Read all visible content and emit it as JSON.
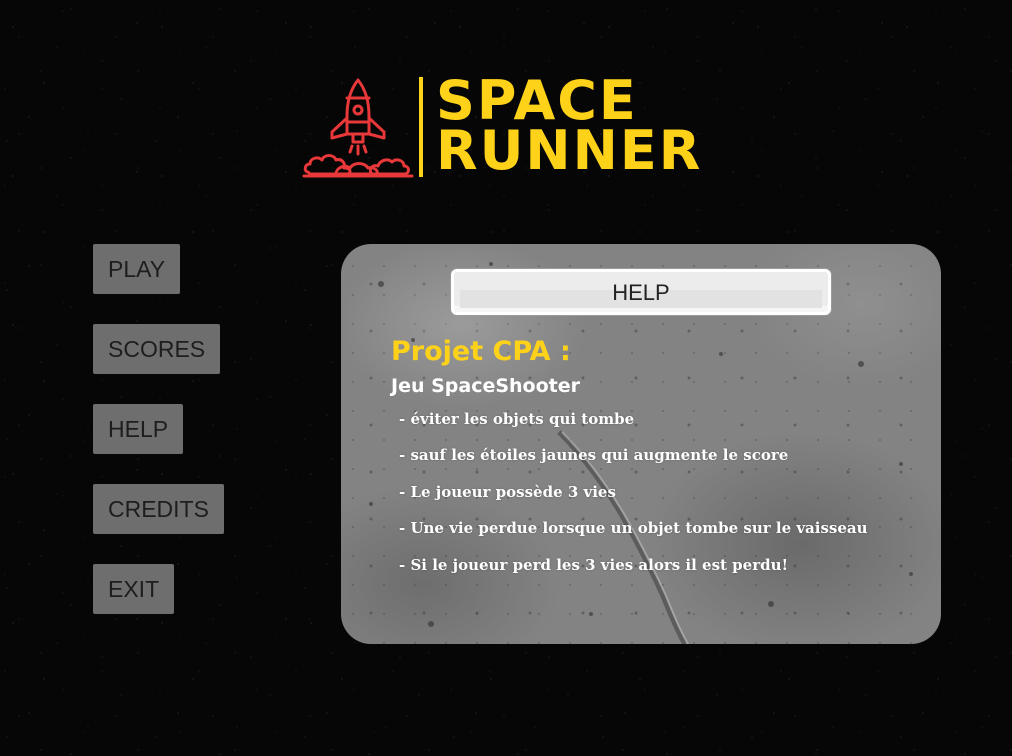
{
  "logo": {
    "line1": "SPACE",
    "line2": "RUNNER",
    "icon": "rocket-launch-icon",
    "colors": {
      "text": "#ffd21a",
      "icon": "#e8383a"
    }
  },
  "menu": {
    "items": [
      {
        "label": "PLAY"
      },
      {
        "label": "SCORES"
      },
      {
        "label": "HELP"
      },
      {
        "label": "CREDITS"
      },
      {
        "label": "EXIT"
      }
    ]
  },
  "help_panel": {
    "title": "HELP",
    "project_title": "Projet CPA :",
    "project_subtitle": "Jeu SpaceShooter",
    "rules": [
      "- éviter les objets qui tombe",
      "- sauf les étoiles jaunes qui augmente le score",
      "- Le joueur possède 3 vies",
      "- Une vie perdue lorsque un objet tombe sur le vaisseau",
      "- Si le joueur perd les 3 vies alors il est perdu!"
    ]
  },
  "colors": {
    "background": "#060606",
    "menu_button": "#6e6e6e",
    "accent": "#ffd21a"
  }
}
